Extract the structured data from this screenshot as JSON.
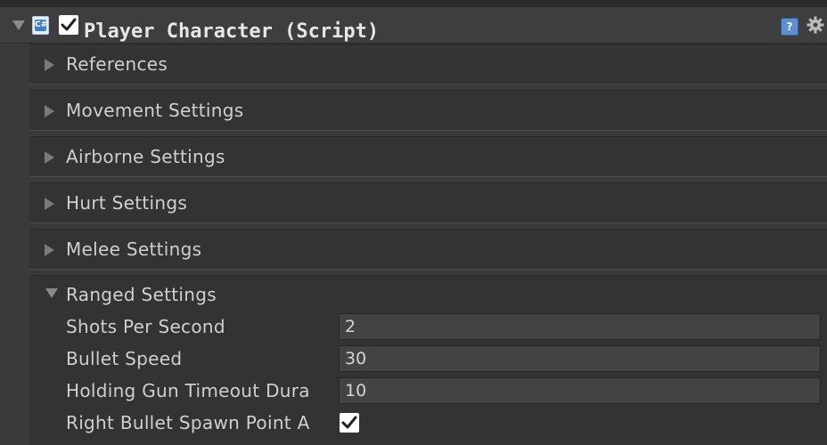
{
  "component": {
    "title": "Player Character (Script)",
    "enabled": true,
    "icons": {
      "fold": "triangle-down-icon",
      "script": "csharp-script-icon",
      "help": "help-book-icon",
      "settings": "gear-icon"
    },
    "script_icon_text": "C#",
    "help_icon_text": "?"
  },
  "groups": [
    {
      "label": "References",
      "expanded": false
    },
    {
      "label": "Movement Settings",
      "expanded": false
    },
    {
      "label": "Airborne Settings",
      "expanded": false
    },
    {
      "label": "Hurt Settings",
      "expanded": false
    },
    {
      "label": "Melee Settings",
      "expanded": false
    },
    {
      "label": "Ranged Settings",
      "expanded": true
    }
  ],
  "ranged": {
    "fields": [
      {
        "label": "Shots Per Second",
        "value": "2"
      },
      {
        "label": "Bullet Speed",
        "value": "30"
      },
      {
        "label": "Holding Gun Timeout Dura",
        "value": "10"
      }
    ],
    "checkbox_field": {
      "label": "Right Bullet Spawn Point A",
      "checked": true
    }
  },
  "colors": {
    "background": "#3a3a3a",
    "group_background": "#333333",
    "field_background": "#434343",
    "text": "#cfcfcf",
    "help_blue": "#5d8fd0"
  }
}
